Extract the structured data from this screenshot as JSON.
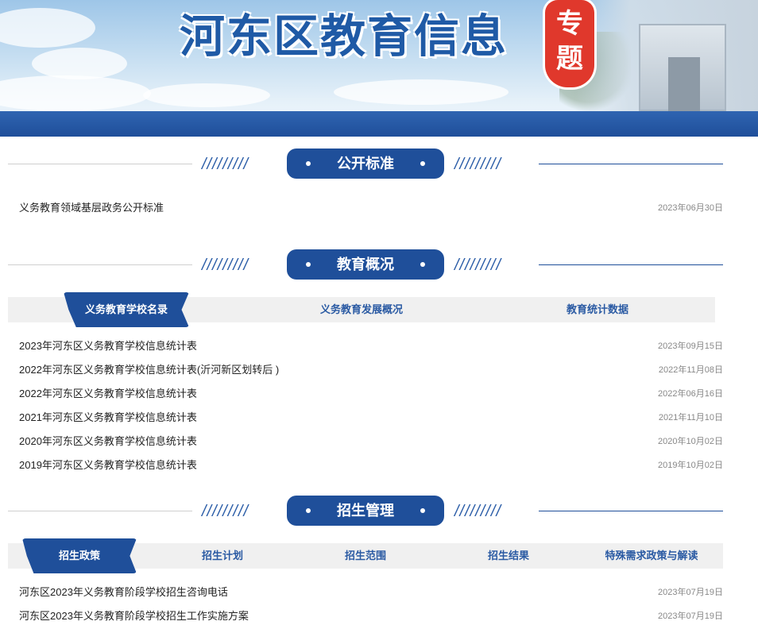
{
  "banner": {
    "title": "河东区教育信息",
    "seal_line1": "专",
    "seal_line2": "题"
  },
  "sections": {
    "open_standard": {
      "title": "公开标准",
      "items": [
        {
          "title": "义务教育领域基层政务公开标准",
          "date": "2023年06月30日"
        }
      ]
    },
    "overview": {
      "title": "教育概况",
      "tabs": [
        {
          "label": "义务教育学校名录",
          "active": true
        },
        {
          "label": "义务教育发展概况",
          "active": false
        },
        {
          "label": "教育统计数据",
          "active": false
        }
      ],
      "items": [
        {
          "title": "2023年河东区义务教育学校信息统计表",
          "date": "2023年09月15日"
        },
        {
          "title": "2022年河东区义务教育学校信息统计表(沂河新区划转后 )",
          "date": "2022年11月08日"
        },
        {
          "title": "2022年河东区义务教育学校信息统计表",
          "date": "2022年06月16日"
        },
        {
          "title": "2021年河东区义务教育学校信息统计表",
          "date": "2021年11月10日"
        },
        {
          "title": "2020年河东区义务教育学校信息统计表",
          "date": "2020年10月02日"
        },
        {
          "title": "2019年河东区义务教育学校信息统计表",
          "date": "2019年10月02日"
        }
      ]
    },
    "enrollment": {
      "title": "招生管理",
      "tabs": [
        {
          "label": "招生政策",
          "active": true
        },
        {
          "label": "招生计划",
          "active": false
        },
        {
          "label": "招生范围",
          "active": false
        },
        {
          "label": "招生结果",
          "active": false
        },
        {
          "label": "特殊需求政策与解读",
          "active": false
        }
      ],
      "items": [
        {
          "title": "河东区2023年义务教育阶段学校招生咨询电话",
          "date": "2023年07月19日"
        },
        {
          "title": "河东区2023年义务教育阶段学校招生工作实施方案",
          "date": "2023年07月19日"
        }
      ]
    }
  },
  "decor": {
    "slashes": "/////////"
  },
  "colors": {
    "primary_blue": "#1f4f9a",
    "seal_red": "#e0382c",
    "tab_bar_gray": "#f0f0f0",
    "date_gray": "#888888"
  }
}
